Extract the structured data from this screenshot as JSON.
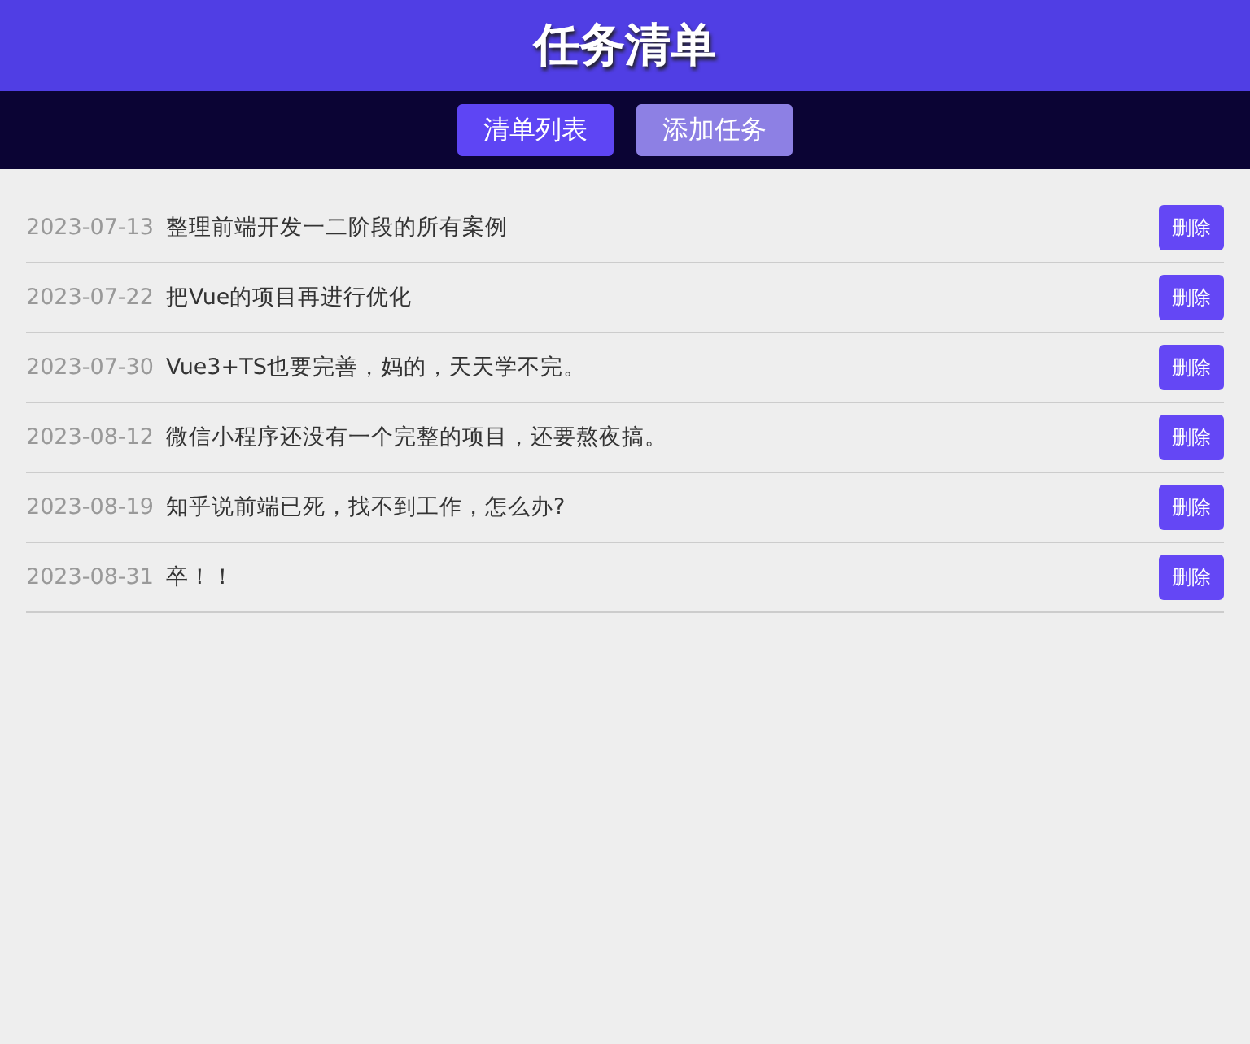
{
  "header": {
    "title": "任务清单"
  },
  "nav": [
    {
      "label": "清单列表",
      "selected": true
    },
    {
      "label": "添加任务",
      "selected": false
    }
  ],
  "tasks": [
    {
      "date": "2023-07-13",
      "text": "整理前端开发一二阶段的所有案例",
      "action": "删除"
    },
    {
      "date": "2023-07-22",
      "text": "把Vue的项目再进行优化",
      "action": "删除"
    },
    {
      "date": "2023-07-30",
      "text": "Vue3+TS也要完善，妈的，天天学不完。",
      "action": "删除"
    },
    {
      "date": "2023-08-12",
      "text": "微信小程序还没有一个完整的项目，还要熬夜搞。",
      "action": "删除"
    },
    {
      "date": "2023-08-19",
      "text": "知乎说前端已死，找不到工作，怎么办?",
      "action": "删除"
    },
    {
      "date": "2023-08-31",
      "text": "卒！！",
      "action": "删除"
    }
  ]
}
